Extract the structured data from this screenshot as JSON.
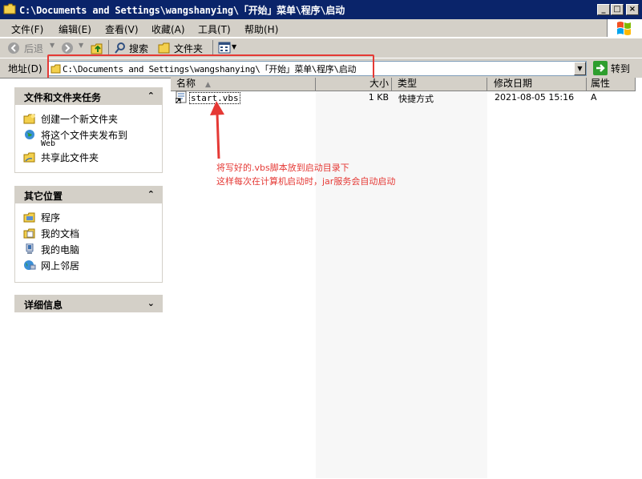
{
  "window": {
    "title": "C:\\Documents and Settings\\wangshanying\\「开始」菜单\\程序\\启动",
    "minimize_glyph": "_",
    "maximize_glyph": "□",
    "close_glyph": "×"
  },
  "menu": {
    "items": [
      "文件(F)",
      "编辑(E)",
      "查看(V)",
      "收藏(A)",
      "工具(T)",
      "帮助(H)"
    ]
  },
  "toolbar": {
    "back_label": "后退",
    "search_label": "搜索",
    "folders_label": "文件夹"
  },
  "address": {
    "label": "地址(D)",
    "value": "C:\\Documents and Settings\\wangshanying\\「开始」菜单\\程序\\启动",
    "go_label": "转到"
  },
  "left_pane": {
    "tasks_title": "文件和文件夹任务",
    "tasks": [
      "创建一个新文件夹",
      "将这个文件夹发布到",
      "Web",
      "共享此文件夹"
    ],
    "places_title": "其它位置",
    "places": [
      "程序",
      "我的文档",
      "我的电脑",
      "网上邻居"
    ],
    "details_title": "详细信息",
    "collapse_glyph": "⌃",
    "expand_glyph": "⌄"
  },
  "columns": {
    "name": "名称",
    "size": "大小",
    "type": "类型",
    "modified": "修改日期",
    "attributes": "属性"
  },
  "files": [
    {
      "name": "start.vbs",
      "size": "1 KB",
      "type": "快捷方式",
      "modified": "2021-08-05 15:16",
      "attributes": "A"
    }
  ],
  "annotation": {
    "line1": "将写好的.vbs脚本放到启动目录下",
    "line2": "这样每次在计算机启动时，jar服务会自动启动",
    "color": "#e53935"
  }
}
